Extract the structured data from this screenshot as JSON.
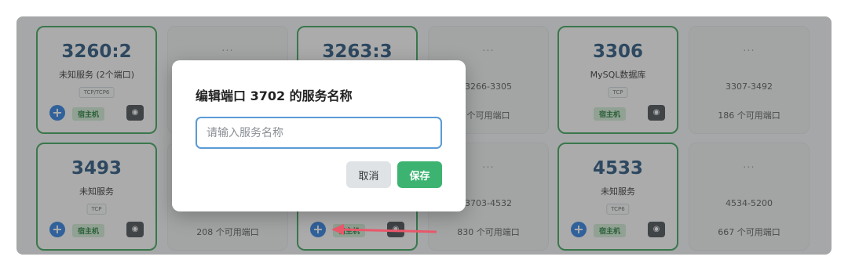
{
  "cards_row1": [
    {
      "type": "used",
      "title": "3260:2",
      "sub": "未知服务 (2个端口)",
      "proto": "TCP/TCP6",
      "add": "+",
      "host": "宿主机",
      "eye": "◉"
    },
    {
      "type": "free",
      "dots": "···",
      "range": "",
      "avail": ""
    },
    {
      "type": "used",
      "title": "3263:3",
      "sub": "",
      "proto": "",
      "add": "",
      "host": "",
      "eye": ""
    },
    {
      "type": "free",
      "dots": "···",
      "range": "3266-3305",
      "avail": "个可用端口"
    },
    {
      "type": "used",
      "title": "3306",
      "sub": "MySQL数据库",
      "proto": "TCP",
      "add": "",
      "host": "宿主机",
      "eye": "◉"
    },
    {
      "type": "free",
      "dots": "···",
      "range": "3307-3492",
      "avail": "186 个可用端口"
    }
  ],
  "cards_row2": [
    {
      "type": "used",
      "title": "3493",
      "sub": "未知服务",
      "proto": "TCP",
      "add": "+",
      "host": "宿主机",
      "eye": "◉"
    },
    {
      "type": "free",
      "dots": "",
      "range": "",
      "avail": "208 个可用端口"
    },
    {
      "type": "used",
      "title": "",
      "sub": "",
      "proto": "",
      "add": "+",
      "host": "宿主机",
      "eye": "◉"
    },
    {
      "type": "free",
      "dots": "···",
      "range": "3703-4532",
      "avail": "830 个可用端口"
    },
    {
      "type": "used",
      "title": "4533",
      "sub": "未知服务",
      "proto": "TCP6",
      "add": "+",
      "host": "宿主机",
      "eye": "◉"
    },
    {
      "type": "free",
      "dots": "···",
      "range": "4534-5200",
      "avail": "667 个可用端口"
    }
  ],
  "modal": {
    "title": "编辑端口 3702 的服务名称",
    "placeholder": "请输入服务名称",
    "cancel": "取消",
    "save": "保存"
  },
  "colors": {
    "accent_green": "#3aa35a",
    "save_green": "#3cb371",
    "add_blue": "#2a7de1",
    "title_blue": "#24527a",
    "arrow": "#e8576a"
  }
}
